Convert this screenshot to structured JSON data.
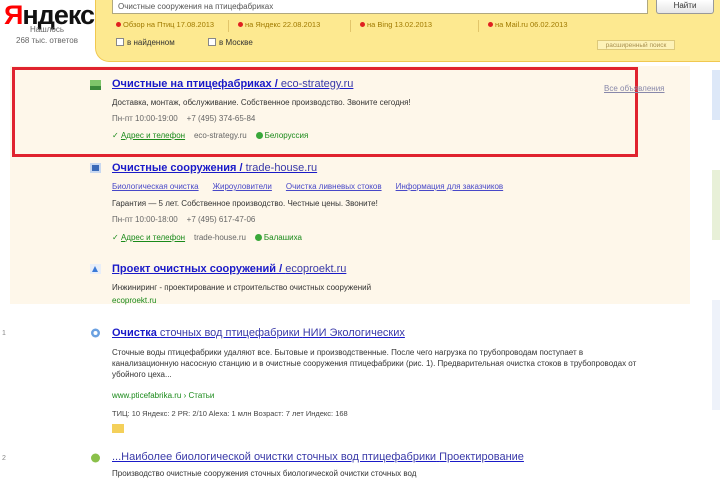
{
  "logo": {
    "first": "Я",
    "rest": "ндекс",
    "sub1": "Нашлось",
    "sub2": "268 тыс. ответов"
  },
  "search": {
    "query": "Очистные сооружения на птицефабриках",
    "button_label": "Найти"
  },
  "wordstat": [
    {
      "label": "Обзор",
      "value": "на Птиц  17.08.2013"
    },
    {
      "label": "",
      "value": "на Яндекс  22.08.2013"
    },
    {
      "label": "",
      "value": "на Bing  13.02.2013"
    },
    {
      "label": "",
      "value": "на Mail.ru  06.02.2013"
    }
  ],
  "filters": {
    "in_found": "в найденном",
    "in_region": "в Москве",
    "advanced": "расширенный поиск"
  },
  "ads": [
    {
      "title": "Очистные на птицефабриках",
      "url": "eco-strategy.ru",
      "desc": "Доставка, монтаж, обслуживание. Собственное производство. Звоните сегодня!",
      "hours": "Пн-пт 10:00-19:00",
      "phone": "+7 (495) 374-65-84",
      "address_link": "Адрес и телефон",
      "domain": "eco-strategy.ru",
      "region": "Белоруссия"
    },
    {
      "title": "Очистные сооружения",
      "url": "trade-house.ru",
      "sitelinks": [
        "Биологическая очистка",
        "Жироуловители",
        "Очистка ливневых стоков",
        "Информация для заказчиков"
      ],
      "desc": "Гарантия — 5 лет. Собственное производство. Честные цены. Звоните!",
      "hours": "Пн-пт 10:00-18:00",
      "phone": "+7 (495) 617-47-06",
      "address_link": "Адрес и телефон",
      "domain": "trade-house.ru",
      "region": "Балашиха"
    },
    {
      "title": "Проект очистных сооружений",
      "url": "ecoproekt.ru",
      "desc": "Инжиниринг - проектирование и строительство очистных сооружений",
      "domain": "ecoproekt.ru"
    }
  ],
  "all_ads_link": "Все объявления",
  "results": [
    {
      "title_bold": "Очистка",
      "title_rest": "сточных вод птицефабрики",
      "title_extra": "НИИ Экологических",
      "snippet": "Сточные воды птицефабрики удаляют все. Бытовые и производственные. После чего нагрузка по трубопроводам поступает в канализационную насосную станцию и в очистные сооружения птицефабрики (рис. 1). Предварительная очистка стоков в трубопроводах от убойного цеха...",
      "url": "www.pticefabrika.ru › Статьи",
      "stats": "ТИЦ: 10   Яндекс: 2   PR: 2/10   Alexa: 1 млн   Возраст: 7 лет   Индекс: 168"
    },
    {
      "title_bold": "",
      "title_rest": "...Наиболее биологической очистки сточных вод птицефабрики",
      "title_extra": "Проектирование",
      "snippet": "Производство очистные сооружения сточных биологической очистки сточных вод"
    }
  ],
  "left_numbers": [
    "1",
    "2"
  ],
  "colors": {
    "highlight": "#e0232f",
    "link": "#1a1ac8",
    "band": "#fde990",
    "ads_bg": "#fef7ea"
  }
}
